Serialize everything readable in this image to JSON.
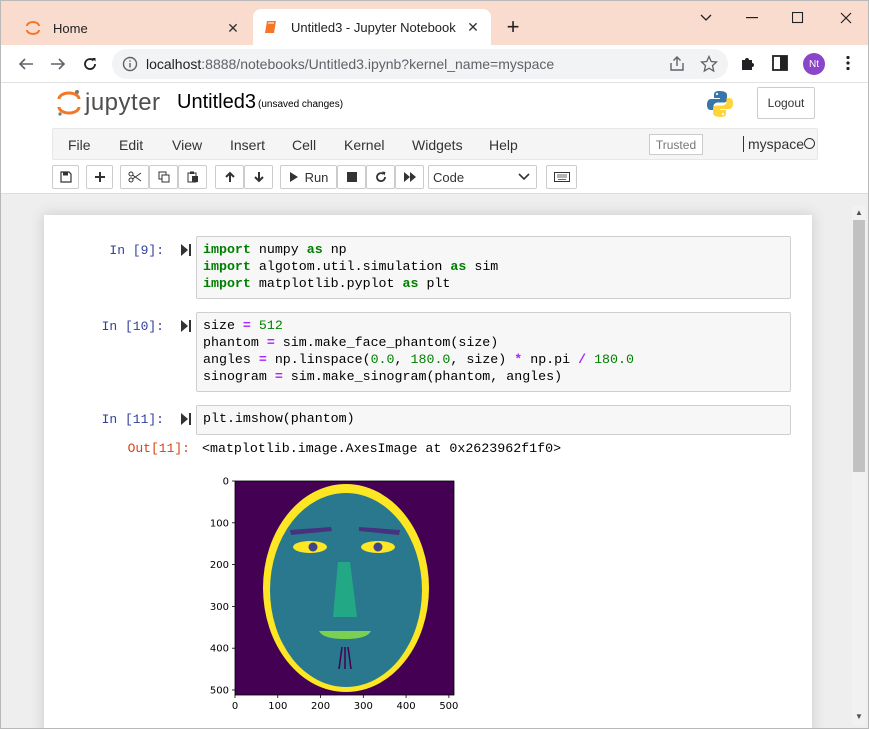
{
  "browser": {
    "tabs": [
      {
        "label": "Home",
        "active": false
      },
      {
        "label": "Untitled3 - Jupyter Notebook",
        "active": true
      }
    ],
    "url_host": "localhost",
    "url_rest": ":8888/notebooks/Untitled3.ipynb?kernel_name=myspace",
    "profile_initials": "Nt",
    "accent": "#f9dccd"
  },
  "jupyter": {
    "wordmark": "jupyter",
    "notebook_name": "Untitled3",
    "save_status": "(unsaved changes)",
    "logout_label": "Logout",
    "menu": [
      "File",
      "Edit",
      "View",
      "Insert",
      "Cell",
      "Kernel",
      "Widgets",
      "Help"
    ],
    "trusted_label": "Trusted",
    "kernel_name": "myspace",
    "run_label": "Run",
    "cell_type": "Code"
  },
  "cells": [
    {
      "prompt": "In [9]:"
    },
    {
      "prompt": "In [10]:"
    },
    {
      "prompt": "In [11]:",
      "out_prompt": "Out[11]:",
      "output": "<matplotlib.image.AxesImage at 0x2623962f1f0>"
    }
  ],
  "plot": {
    "y_ticks": [
      "0",
      "100",
      "200",
      "300",
      "400",
      "500"
    ],
    "x_ticks": [
      "0",
      "100",
      "200",
      "300",
      "400",
      "500"
    ]
  }
}
